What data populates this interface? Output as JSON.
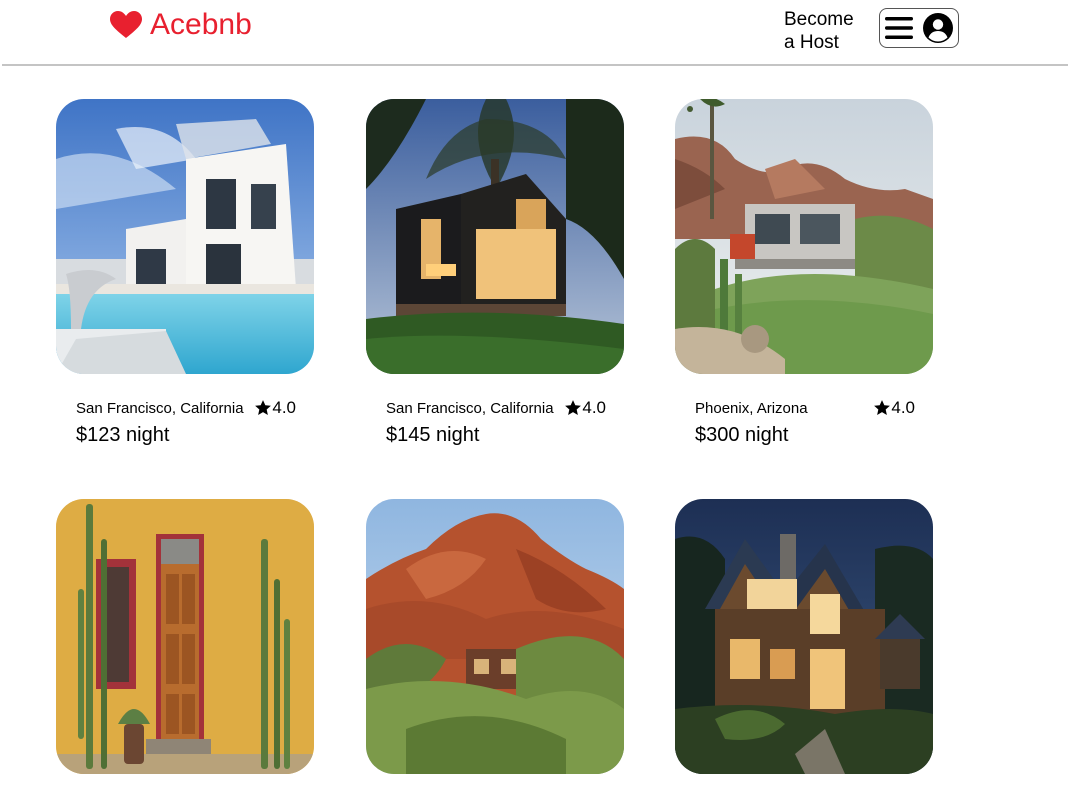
{
  "header": {
    "logo_text": "Acebnb",
    "become_host_line1": "Become",
    "become_host_line2": "a Host",
    "menu_icon": "hamburger-menu-icon",
    "account_icon": "user-circle-icon"
  },
  "colors": {
    "brand": "#e8202f"
  },
  "listings": [
    {
      "location": "San Francisco, California",
      "rating": "4.0",
      "price": "$123 night",
      "photo": "modern white villa with pool"
    },
    {
      "location": "San Francisco, California",
      "rating": "4.0",
      "price": "$145 night",
      "photo": "modern dark house with tree at dusk"
    },
    {
      "location": "Phoenix, Arizona",
      "rating": "4.0",
      "price": "$300 night",
      "photo": "desert house with cactus garden"
    },
    {
      "photo": "yellow adobe wall with wooden door and cacti"
    },
    {
      "photo": "red rock cliffs with house among trees"
    },
    {
      "photo": "wooden A-frame house lit at night"
    }
  ]
}
